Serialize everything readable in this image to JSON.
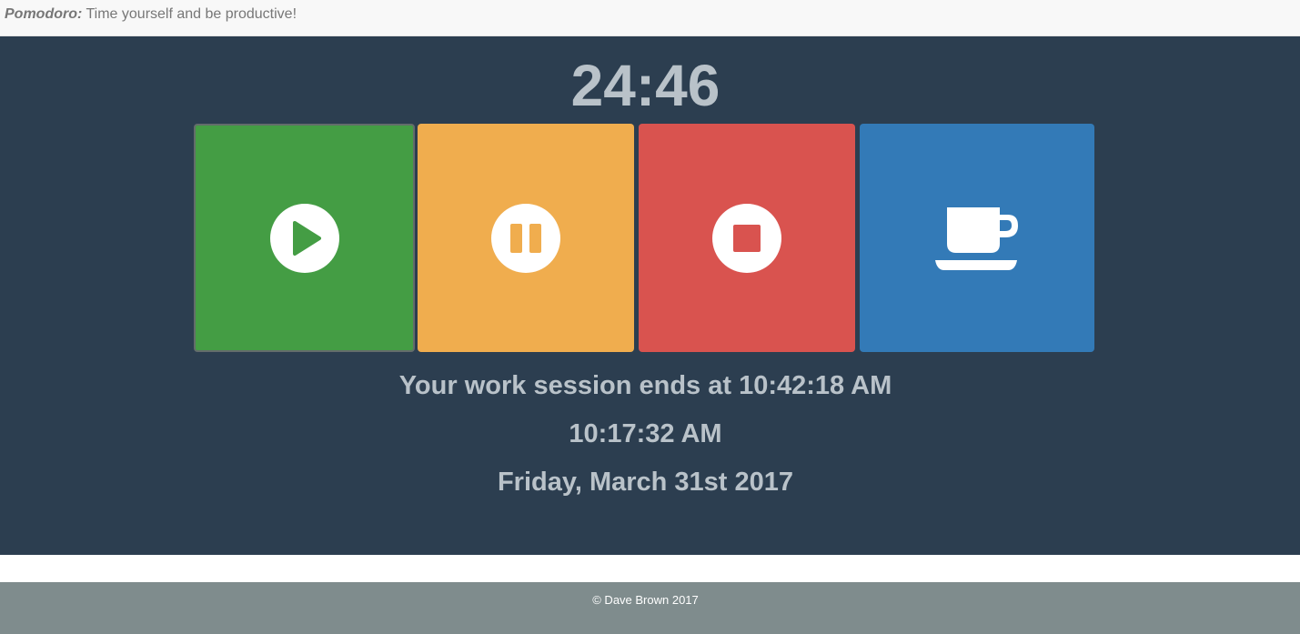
{
  "header": {
    "brand_name": "Pomodoro:",
    "tagline": "Time yourself and be productive!"
  },
  "timer": {
    "countdown": "24:46"
  },
  "controls": [
    {
      "name": "start",
      "icon": "play-icon",
      "color": "#449d44"
    },
    {
      "name": "pause",
      "icon": "pause-icon",
      "color": "#f0ad4e"
    },
    {
      "name": "stop",
      "icon": "stop-icon",
      "color": "#d9534f"
    },
    {
      "name": "break",
      "icon": "coffee-cup-icon",
      "color": "#337ab7"
    }
  ],
  "session": {
    "ends_text": "Your work session ends at 10:42:18 AM",
    "current_time": "10:17:32 AM",
    "current_date": "Friday, March 31st 2017"
  },
  "footer": {
    "copyright": "© Dave Brown 2017"
  },
  "colors": {
    "main_background": "#2c3e50",
    "text_light": "#b9c2c9",
    "footer_background": "#7f8c8d",
    "topbar_background": "#f8f8f8"
  }
}
